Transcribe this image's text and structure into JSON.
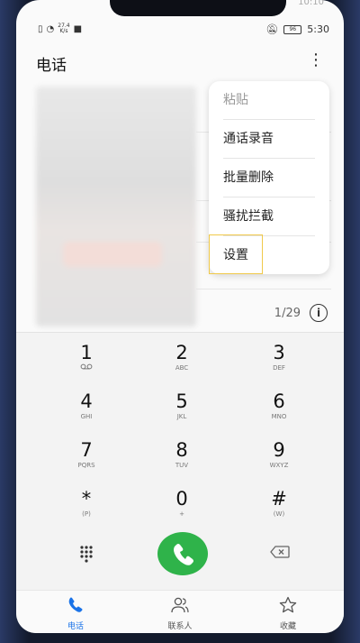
{
  "status_bar": {
    "speed_top": "27.4",
    "speed_bottom": "K/s",
    "battery": "96",
    "time": "5:30",
    "peek_time": "10:10"
  },
  "app": {
    "title": "电话"
  },
  "menu": {
    "items": [
      {
        "label": "粘贴",
        "disabled": true
      },
      {
        "label": "通话录音"
      },
      {
        "label": "批量删除"
      },
      {
        "label": "骚扰拦截"
      },
      {
        "label": "设置"
      }
    ]
  },
  "call_log": {
    "page_count": "1/29"
  },
  "dialpad": {
    "keys": [
      {
        "num": "1",
        "sub": "voicemail-icon"
      },
      {
        "num": "2",
        "sub": "ABC"
      },
      {
        "num": "3",
        "sub": "DEF"
      },
      {
        "num": "4",
        "sub": "GHI"
      },
      {
        "num": "5",
        "sub": "JKL"
      },
      {
        "num": "6",
        "sub": "MNO"
      },
      {
        "num": "7",
        "sub": "PQRS"
      },
      {
        "num": "8",
        "sub": "TUV"
      },
      {
        "num": "9",
        "sub": "WXYZ"
      },
      {
        "num": "*",
        "sub": "(P)"
      },
      {
        "num": "0",
        "sub": "+"
      },
      {
        "num": "#",
        "sub": "(W)"
      }
    ]
  },
  "tabs": [
    {
      "label": "电话",
      "icon": "phone-icon",
      "active": true
    },
    {
      "label": "联系人",
      "icon": "contacts-icon"
    },
    {
      "label": "收藏",
      "icon": "star-icon"
    }
  ],
  "colors": {
    "accent": "#1a73e8",
    "call": "#2fb34a",
    "highlight": "#f0c94a"
  }
}
